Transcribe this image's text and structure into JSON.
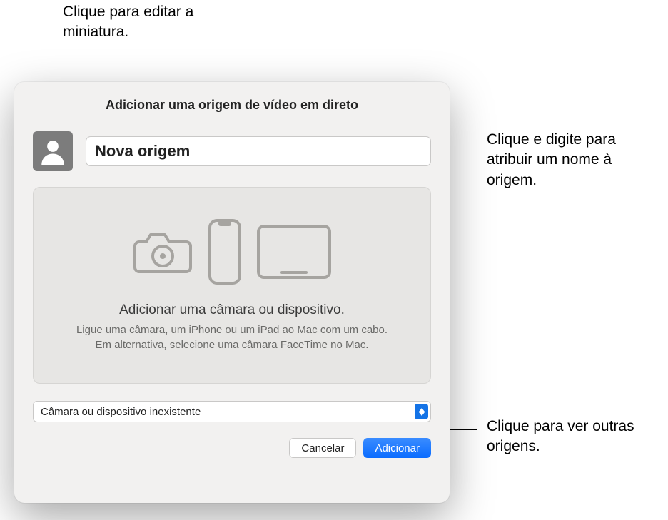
{
  "callouts": {
    "thumbnail": "Clique para editar a miniatura.",
    "name": "Clique e digite para atribuir um nome à origem.",
    "sources": "Clique para ver outras origens."
  },
  "dialog": {
    "title": "Adicionar uma origem de vídeo em direto",
    "source_name": "Nova origem",
    "panel": {
      "heading": "Adicionar uma câmara ou dispositivo.",
      "line1": "Ligue uma câmara, um iPhone ou um iPad ao Mac com um cabo.",
      "line2": "Em alternativa, selecione uma câmara FaceTime no Mac."
    },
    "dropdown": {
      "selected": "Câmara ou dispositivo inexistente"
    },
    "buttons": {
      "cancel": "Cancelar",
      "add": "Adicionar"
    }
  }
}
